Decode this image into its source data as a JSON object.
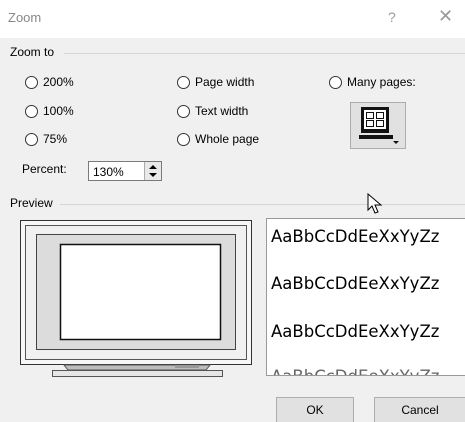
{
  "window": {
    "title": "Zoom",
    "help_label": "?",
    "close_label": "✕"
  },
  "zoom_to": {
    "label": "Zoom to",
    "options": {
      "p200": "200%",
      "p100": "100%",
      "p75": "75%",
      "page_width": "Page width",
      "text_width": "Text width",
      "whole_page": "Whole page",
      "many_pages": "Many pages:"
    },
    "many_pages_icon": "multiple-pages-monitor-icon"
  },
  "percent": {
    "label": "Percent:",
    "value": "130%"
  },
  "preview": {
    "label": "Preview",
    "sample_lines": [
      "AaBbCcDdEeXxYyZz",
      "AaBbCcDdEeXxYyZz",
      "AaBbCcDdEeXxYyZz"
    ]
  },
  "buttons": {
    "ok": "OK",
    "cancel": "Cancel"
  },
  "colors": {
    "dialog_bg": "#f0f0f0",
    "titlebar_bg": "#ffffff",
    "button_bg": "#e1e1e1"
  }
}
